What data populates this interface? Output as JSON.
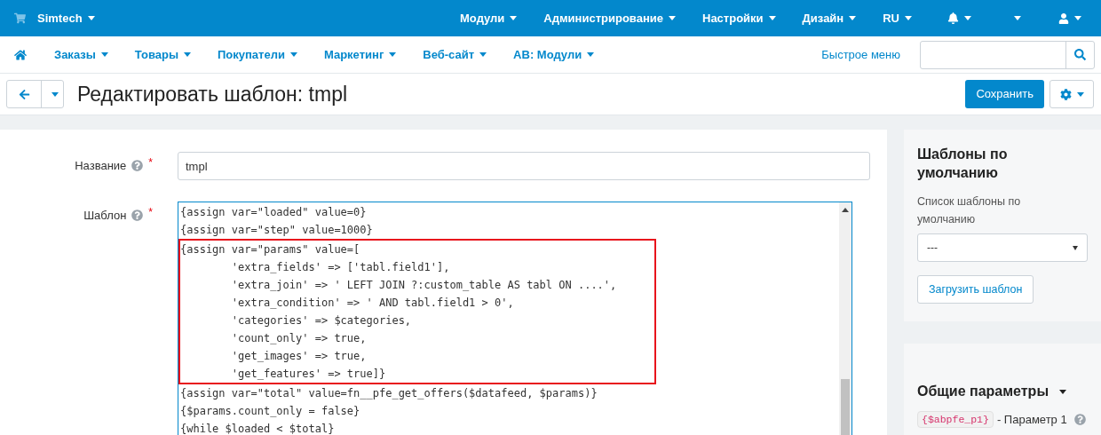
{
  "top_bar": {
    "store": "Simtech",
    "menus": [
      "Модули",
      "Администрирование",
      "Настройки",
      "Дизайн",
      "RU"
    ]
  },
  "main_nav": {
    "items": [
      "Заказы",
      "Товары",
      "Покупатели",
      "Маркетинг",
      "Веб-сайт",
      "AB: Модули"
    ],
    "quick_menu": "Быстрое меню"
  },
  "title_bar": {
    "title": "Редактировать шаблон: tmpl",
    "save": "Сохранить"
  },
  "form": {
    "fields": [
      {
        "label": "Название",
        "required_mark": "*",
        "kind": "input",
        "value": "tmpl"
      },
      {
        "label": "Шаблон",
        "required_mark": "*",
        "kind": "code",
        "lines_before": [
          "{assign var=\"loaded\" value=0}",
          "{assign var=\"step\" value=1000}"
        ],
        "highlighted_lines": [
          "{assign var=\"params\" value=[",
          "        'extra_fields' => ['tabl.field1'],",
          "        'extra_join' => ' LEFT JOIN ?:custom_table AS tabl ON ....',",
          "        'extra_condition' => ' AND tabl.field1 > 0',",
          "        'categories' => $categories,",
          "        'count_only' => true,",
          "        'get_images' => true,",
          "        'get_features' => true]}"
        ],
        "lines_after": [
          "{assign var=\"total\" value=fn__pfe_get_offers($datafeed, $params)}",
          "{$params.count_only = false}",
          "{while $loaded < $total}"
        ]
      }
    ]
  },
  "sidebar": {
    "default_templates": {
      "title": "Шаблоны по умолчанию",
      "label": "Список шаблоны по умолчанию",
      "select_value": "---",
      "button": "Загрузить шаблон"
    },
    "general_params": {
      "title": "Общие параметры",
      "params": [
        {
          "code": "{$abpfe_p1}",
          "text": "- Параметр 1"
        }
      ]
    }
  }
}
